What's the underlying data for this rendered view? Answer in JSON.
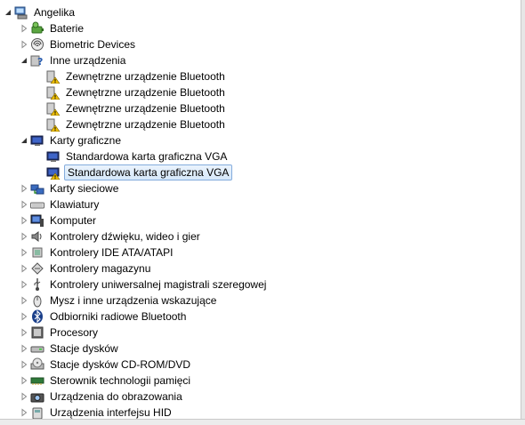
{
  "tree": {
    "root": {
      "label": "Angelika",
      "icon": "computer-icon",
      "expanded": true
    },
    "categories": [
      {
        "label": "Baterie",
        "icon": "battery-icon",
        "expanded": false
      },
      {
        "label": "Biometric Devices",
        "icon": "fingerprint-icon",
        "expanded": false
      },
      {
        "label": "Inne urządzenia",
        "icon": "unknown-device-icon",
        "expanded": true,
        "children": [
          {
            "label": "Zewnętrzne urządzenie Bluetooth",
            "icon": "warning-device-icon"
          },
          {
            "label": "Zewnętrzne urządzenie Bluetooth",
            "icon": "warning-device-icon"
          },
          {
            "label": "Zewnętrzne urządzenie Bluetooth",
            "icon": "warning-device-icon"
          },
          {
            "label": "Zewnętrzne urządzenie Bluetooth",
            "icon": "warning-device-icon"
          }
        ]
      },
      {
        "label": "Karty graficzne",
        "icon": "display-adapter-icon",
        "expanded": true,
        "children": [
          {
            "label": "Standardowa karta graficzna VGA",
            "icon": "display-adapter-icon",
            "selected": false
          },
          {
            "label": "Standardowa karta graficzna VGA",
            "icon": "display-adapter-warning-icon",
            "selected": true
          }
        ]
      },
      {
        "label": "Karty sieciowe",
        "icon": "network-icon",
        "expanded": false
      },
      {
        "label": "Klawiatury",
        "icon": "keyboard-icon",
        "expanded": false
      },
      {
        "label": "Komputer",
        "icon": "monitor-icon",
        "expanded": false
      },
      {
        "label": "Kontrolery dźwięku, wideo i gier",
        "icon": "speaker-icon",
        "expanded": false
      },
      {
        "label": "Kontrolery IDE ATA/ATAPI",
        "icon": "ide-icon",
        "expanded": false
      },
      {
        "label": "Kontrolery magazynu",
        "icon": "storage-icon",
        "expanded": false
      },
      {
        "label": "Kontrolery uniwersalnej magistrali szeregowej",
        "icon": "usb-icon",
        "expanded": false
      },
      {
        "label": "Mysz i inne urządzenia wskazujące",
        "icon": "mouse-icon",
        "expanded": false
      },
      {
        "label": "Odbiorniki radiowe Bluetooth",
        "icon": "bluetooth-icon",
        "expanded": false
      },
      {
        "label": "Procesory",
        "icon": "cpu-icon",
        "expanded": false
      },
      {
        "label": "Stacje dysków",
        "icon": "disk-icon",
        "expanded": false
      },
      {
        "label": "Stacje dysków CD-ROM/DVD",
        "icon": "cdrom-icon",
        "expanded": false
      },
      {
        "label": "Sterownik technologii pamięci",
        "icon": "memory-icon",
        "expanded": false
      },
      {
        "label": "Urządzenia do obrazowania",
        "icon": "camera-icon",
        "expanded": false
      },
      {
        "label": "Urządzenia interfejsu HID",
        "icon": "hid-icon",
        "expanded": false
      }
    ]
  },
  "colors": {
    "selection_bg": "#d6e8fa",
    "selection_border": "#84acdd",
    "warning": "#f2c200"
  }
}
